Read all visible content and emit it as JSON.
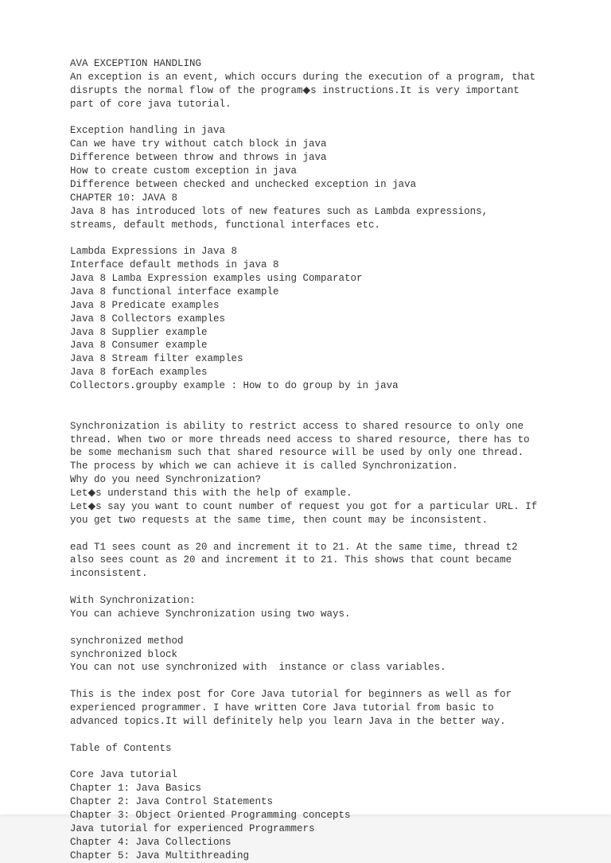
{
  "doc": {
    "heading": "AVA EXCEPTION HANDLING",
    "p1": "An exception is an event, which occurs during the execution of a program, that disrupts the normal flow of the program◆s instructions.It is very important part of core java tutorial.",
    "exc_head": "Exception handling in java",
    "exc_l1": "Can we have try without catch block in java",
    "exc_l2": "Difference between throw and throws in java",
    "exc_l3": "How to create custom exception in java",
    "exc_l4": "Difference between checked and unchecked exception in java",
    "ch10": "CHAPTER 10: JAVA 8",
    "ch10_p": "Java 8 has introduced lots of new features such as Lambda expressions, streams, default methods, functional interfaces etc.",
    "j8_l1": "Lambda Expressions in Java 8",
    "j8_l2": "Interface default methods in java 8",
    "j8_l3": "Java 8 Lamba Expression examples using Comparator",
    "j8_l4": "Java 8 functional interface example",
    "j8_l5": "Java 8 Predicate examples",
    "j8_l6": "Java 8 Collectors examples",
    "j8_l7": "Java 8 Supplier example",
    "j8_l8": "Java 8 Consumer example",
    "j8_l9": "Java 8 Stream filter examples",
    "j8_l10": "Java 8 forEach examples",
    "j8_l11": "Collectors.groupby example : How to do group by in java",
    "sync_p1": "Synchronization is ability to restrict access to shared resource to only one thread. When two or more threads need access to shared resource, there has to be some mechanism such that shared resource will be used by only one thread. The process by which we can achieve it is called Synchronization.",
    "sync_q": "Why do you need Synchronization?",
    "sync_u1": "Let◆s understand this with the help of example.",
    "sync_u2": "Let◆s say you want to count number of request you got for a particular URL. If you get two requests at the same time, then count may be inconsistent.",
    "sync_ead": "ead T1 sees count as 20 and increment it to 21. At the same time, thread t2 also sees count as 20 and increment it to 21. This shows that count became inconsistent.",
    "sync_with": "With Synchronization:",
    "sync_ways": "You can achieve Synchronization using two ways.",
    "sync_m": "synchronized method",
    "sync_b": "synchronized block",
    "sync_note": "You can not use synchronized with  instance or class variables.",
    "idx_p": "This is the index post for Core Java tutorial for beginners as well as for experienced programmer. I have written Core Java tutorial from basic to advanced topics.It will definitely help you learn Java in the better way.",
    "toc": "Table of Contents",
    "toc_l1": "Core Java tutorial",
    "toc_l2": "Chapter 1: Java Basics",
    "toc_l3": "Chapter 2: Java Control Statements",
    "toc_l4": "Chapter 3: Object Oriented Programming concepts",
    "toc_l5": "Java tutorial for experienced Programmers",
    "toc_l6": "Chapter 4: Java Collections",
    "toc_l7": "Chapter 5: Java Multithreading"
  }
}
